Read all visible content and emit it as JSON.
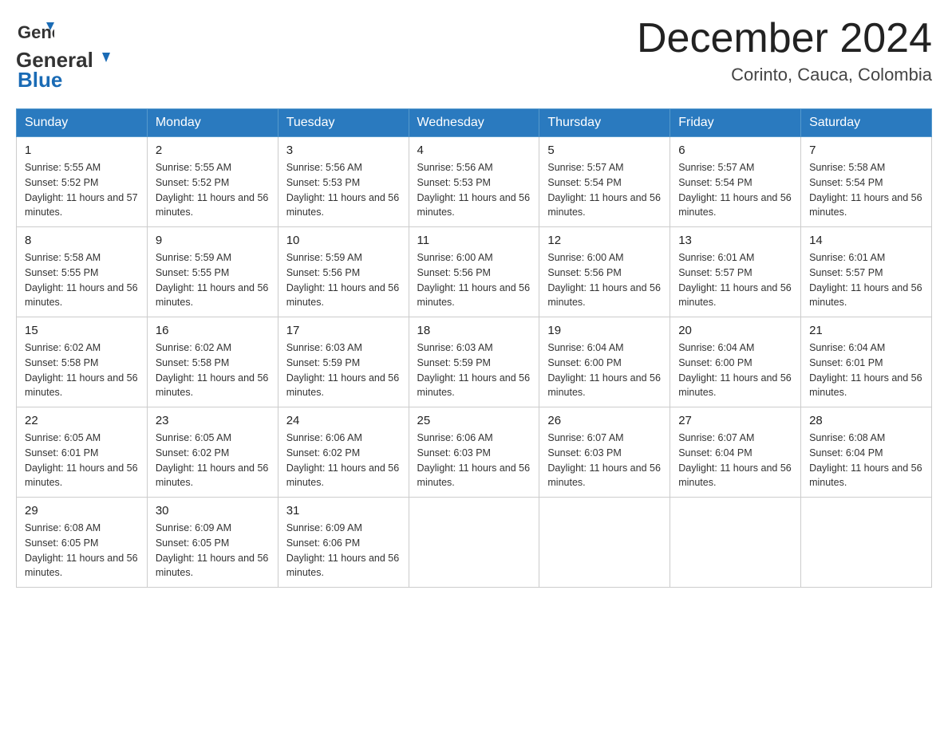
{
  "header": {
    "logo_general": "General",
    "logo_blue": "Blue",
    "month_title": "December 2024",
    "subtitle": "Corinto, Cauca, Colombia"
  },
  "weekdays": [
    "Sunday",
    "Monday",
    "Tuesday",
    "Wednesday",
    "Thursday",
    "Friday",
    "Saturday"
  ],
  "weeks": [
    [
      {
        "day": "1",
        "sunrise": "5:55 AM",
        "sunset": "5:52 PM",
        "daylight": "11 hours and 57 minutes."
      },
      {
        "day": "2",
        "sunrise": "5:55 AM",
        "sunset": "5:52 PM",
        "daylight": "11 hours and 56 minutes."
      },
      {
        "day": "3",
        "sunrise": "5:56 AM",
        "sunset": "5:53 PM",
        "daylight": "11 hours and 56 minutes."
      },
      {
        "day": "4",
        "sunrise": "5:56 AM",
        "sunset": "5:53 PM",
        "daylight": "11 hours and 56 minutes."
      },
      {
        "day": "5",
        "sunrise": "5:57 AM",
        "sunset": "5:54 PM",
        "daylight": "11 hours and 56 minutes."
      },
      {
        "day": "6",
        "sunrise": "5:57 AM",
        "sunset": "5:54 PM",
        "daylight": "11 hours and 56 minutes."
      },
      {
        "day": "7",
        "sunrise": "5:58 AM",
        "sunset": "5:54 PM",
        "daylight": "11 hours and 56 minutes."
      }
    ],
    [
      {
        "day": "8",
        "sunrise": "5:58 AM",
        "sunset": "5:55 PM",
        "daylight": "11 hours and 56 minutes."
      },
      {
        "day": "9",
        "sunrise": "5:59 AM",
        "sunset": "5:55 PM",
        "daylight": "11 hours and 56 minutes."
      },
      {
        "day": "10",
        "sunrise": "5:59 AM",
        "sunset": "5:56 PM",
        "daylight": "11 hours and 56 minutes."
      },
      {
        "day": "11",
        "sunrise": "6:00 AM",
        "sunset": "5:56 PM",
        "daylight": "11 hours and 56 minutes."
      },
      {
        "day": "12",
        "sunrise": "6:00 AM",
        "sunset": "5:56 PM",
        "daylight": "11 hours and 56 minutes."
      },
      {
        "day": "13",
        "sunrise": "6:01 AM",
        "sunset": "5:57 PM",
        "daylight": "11 hours and 56 minutes."
      },
      {
        "day": "14",
        "sunrise": "6:01 AM",
        "sunset": "5:57 PM",
        "daylight": "11 hours and 56 minutes."
      }
    ],
    [
      {
        "day": "15",
        "sunrise": "6:02 AM",
        "sunset": "5:58 PM",
        "daylight": "11 hours and 56 minutes."
      },
      {
        "day": "16",
        "sunrise": "6:02 AM",
        "sunset": "5:58 PM",
        "daylight": "11 hours and 56 minutes."
      },
      {
        "day": "17",
        "sunrise": "6:03 AM",
        "sunset": "5:59 PM",
        "daylight": "11 hours and 56 minutes."
      },
      {
        "day": "18",
        "sunrise": "6:03 AM",
        "sunset": "5:59 PM",
        "daylight": "11 hours and 56 minutes."
      },
      {
        "day": "19",
        "sunrise": "6:04 AM",
        "sunset": "6:00 PM",
        "daylight": "11 hours and 56 minutes."
      },
      {
        "day": "20",
        "sunrise": "6:04 AM",
        "sunset": "6:00 PM",
        "daylight": "11 hours and 56 minutes."
      },
      {
        "day": "21",
        "sunrise": "6:04 AM",
        "sunset": "6:01 PM",
        "daylight": "11 hours and 56 minutes."
      }
    ],
    [
      {
        "day": "22",
        "sunrise": "6:05 AM",
        "sunset": "6:01 PM",
        "daylight": "11 hours and 56 minutes."
      },
      {
        "day": "23",
        "sunrise": "6:05 AM",
        "sunset": "6:02 PM",
        "daylight": "11 hours and 56 minutes."
      },
      {
        "day": "24",
        "sunrise": "6:06 AM",
        "sunset": "6:02 PM",
        "daylight": "11 hours and 56 minutes."
      },
      {
        "day": "25",
        "sunrise": "6:06 AM",
        "sunset": "6:03 PM",
        "daylight": "11 hours and 56 minutes."
      },
      {
        "day": "26",
        "sunrise": "6:07 AM",
        "sunset": "6:03 PM",
        "daylight": "11 hours and 56 minutes."
      },
      {
        "day": "27",
        "sunrise": "6:07 AM",
        "sunset": "6:04 PM",
        "daylight": "11 hours and 56 minutes."
      },
      {
        "day": "28",
        "sunrise": "6:08 AM",
        "sunset": "6:04 PM",
        "daylight": "11 hours and 56 minutes."
      }
    ],
    [
      {
        "day": "29",
        "sunrise": "6:08 AM",
        "sunset": "6:05 PM",
        "daylight": "11 hours and 56 minutes."
      },
      {
        "day": "30",
        "sunrise": "6:09 AM",
        "sunset": "6:05 PM",
        "daylight": "11 hours and 56 minutes."
      },
      {
        "day": "31",
        "sunrise": "6:09 AM",
        "sunset": "6:06 PM",
        "daylight": "11 hours and 56 minutes."
      },
      null,
      null,
      null,
      null
    ]
  ]
}
